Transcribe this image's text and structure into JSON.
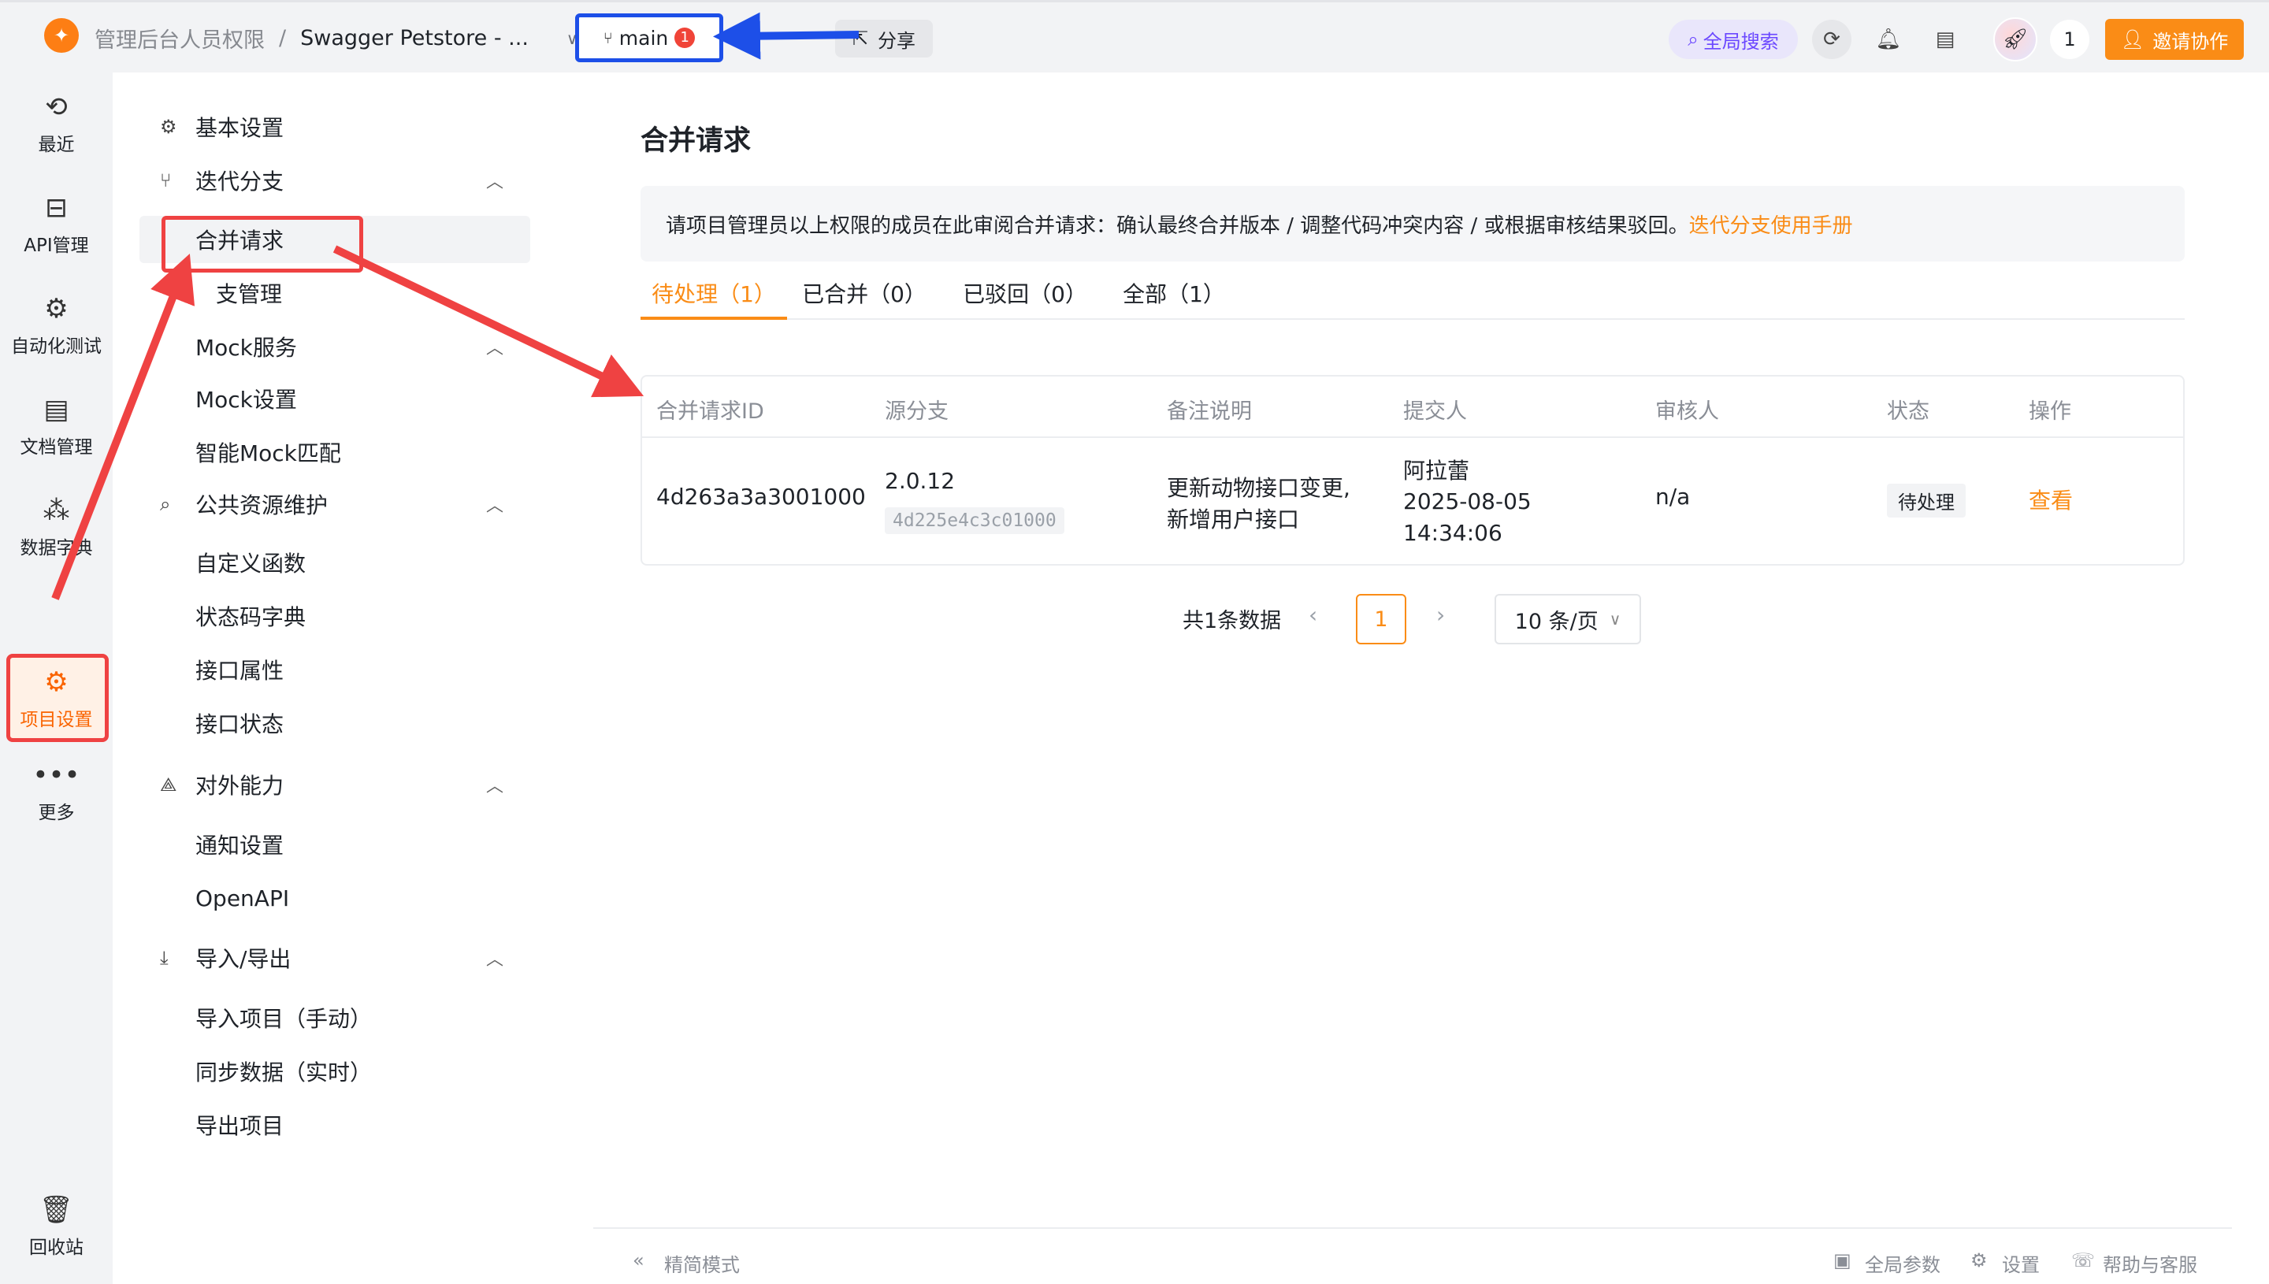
{
  "header": {
    "breadcrumb_team": "管理后台人员权限",
    "breadcrumb_sep": "/",
    "breadcrumb_project": "Swagger Petstore - ...",
    "branch_name": "main",
    "branch_badge": "1",
    "share_label": "分享",
    "search_label": "全局搜索",
    "user_count": "1",
    "invite_label": "邀请协作"
  },
  "rail": {
    "items": [
      {
        "label": "最近",
        "icon": "history-icon"
      },
      {
        "label": "API管理",
        "icon": "api-icon"
      },
      {
        "label": "自动化测试",
        "icon": "automation-icon"
      },
      {
        "label": "文档管理",
        "icon": "document-icon"
      },
      {
        "label": "数据字典",
        "icon": "data-dictionary-icon"
      },
      {
        "label": "项目设置",
        "icon": "project-settings-icon"
      },
      {
        "label": "更多",
        "icon": "more-icon"
      },
      {
        "label": "回收站",
        "icon": "trash-icon"
      }
    ]
  },
  "subnav": {
    "basic_settings": "基本设置",
    "iteration_branch": "迭代分支",
    "merge_request": "合并请求",
    "branch_management": "支管理",
    "mock_service": "Mock服务",
    "mock_settings": "Mock设置",
    "smart_mock": "智能Mock匹配",
    "public_resources": "公共资源维护",
    "custom_functions": "自定义函数",
    "status_codes": "状态码字典",
    "api_properties": "接口属性",
    "api_status": "接口状态",
    "external_capabilities": "对外能力",
    "notification_settings": "通知设置",
    "openapi": "OpenAPI",
    "import_export": "导入/导出",
    "import_manual": "导入项目（手动）",
    "sync_realtime": "同步数据（实时）",
    "export_project": "导出项目"
  },
  "main": {
    "title": "合并请求",
    "notice_text": "请项目管理员以上权限的成员在此审阅合并请求：确认最终合并版本 / 调整代码冲突内容 / 或根据审核结果驳回。",
    "notice_link": "迭代分支使用手册",
    "tabs": [
      {
        "label": "待处理（1）"
      },
      {
        "label": "已合并（0）"
      },
      {
        "label": "已驳回（0）"
      },
      {
        "label": "全部（1）"
      }
    ],
    "columns": [
      "合并请求ID",
      "源分支",
      "备注说明",
      "提交人",
      "审核人",
      "状态",
      "操作"
    ],
    "rows": [
      {
        "id": "4d263a3a3001000",
        "branch": "2.0.12",
        "branch_hash": "4d225e4c3c01000",
        "note_line1": "更新动物接口变更,",
        "note_line2": "新增用户接口",
        "submitter": "阿拉蕾",
        "date": "2025-08-05",
        "time": "14:34:06",
        "reviewer": "n/a",
        "status": "待处理",
        "action": "查看"
      }
    ],
    "pagination": {
      "total": "共1条数据",
      "current": "1",
      "page_size": "10 条/页"
    }
  },
  "footer": {
    "simple_mode": "精简模式",
    "global_params": "全局参数",
    "settings": "设置",
    "help": "帮助与客服"
  },
  "colors": {
    "accent": "#fa8c16",
    "annotation_red": "#ef4242",
    "annotation_blue": "#1d4fe8"
  }
}
